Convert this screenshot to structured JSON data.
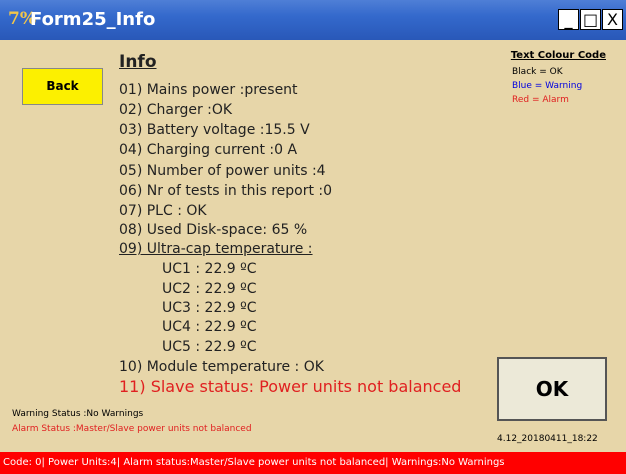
{
  "window": {
    "title": "Form25_Info",
    "app_icon": "7%",
    "buttons": {
      "minimize": "_",
      "maximize": "□",
      "close": "X"
    }
  },
  "back_button": "Back",
  "info": {
    "title": "Info",
    "lines": [
      "01) Mains power :present",
      "02) Charger :OK",
      "03) Battery voltage :15.5 V",
      "04) Charging current :0 A",
      "05) Number  of power units :4",
      "06) Nr of tests in this report :0",
      "07) PLC : OK",
      "08) Used Disk-space: 65 %",
      "09) Ultra-cap temperature :",
      "UC1 : 22.9 ºC",
      "UC2 : 22.9 ºC",
      "UC3 : 22.9 ºC",
      "UC4 : 22.9 ºC",
      "UC5 : 22.9 ºC",
      "10) Module temperature : OK",
      "11) Slave status: Power units not balanced"
    ]
  },
  "legend": {
    "title": "Text Colour Code",
    "items": [
      {
        "label": "Black = OK",
        "color": "#000000"
      },
      {
        "label": "Blue = Warning",
        "color": "#0000e0"
      },
      {
        "label": "Red = Alarm",
        "color": "#e02020"
      }
    ]
  },
  "ok_button": "OK",
  "warning_status": "Warning Status :No Warnings",
  "alarm_status": "Alarm Status :Master/Slave power units not balanced",
  "version": "4.12_20180411_18:22",
  "statusbar": "Code: 0| Power Units:4| Alarm status:Master/Slave power units not balanced| Warnings:No Warnings",
  "colors": {
    "titlebar": "#3469cc",
    "background": "#e7d6a9",
    "back_button": "#fcf000",
    "alarm": "#e02020",
    "statusbar": "#ff0000"
  }
}
